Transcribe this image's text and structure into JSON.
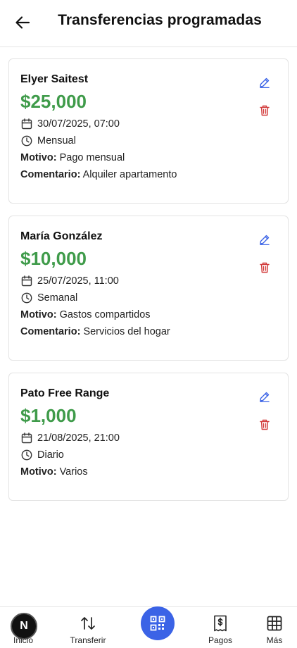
{
  "header": {
    "title": "Transferencias programadas"
  },
  "transfers": [
    {
      "recipient": "Elyer Saitest",
      "amount": "$25,000",
      "datetime": "30/07/2025, 07:00",
      "frequency": "Mensual",
      "motivo_label": "Motivo:",
      "motivo": "Pago mensual",
      "comentario_label": "Comentario:",
      "comentario": "Alquiler apartamento"
    },
    {
      "recipient": "María González",
      "amount": "$10,000",
      "datetime": "25/07/2025, 11:00",
      "frequency": "Semanal",
      "motivo_label": "Motivo:",
      "motivo": "Gastos compartidos",
      "comentario_label": "Comentario:",
      "comentario": "Servicios del hogar"
    },
    {
      "recipient": "Pato Free Range",
      "amount": "$1,000",
      "datetime": "21/08/2025, 21:00",
      "frequency": "Diario",
      "motivo_label": "Motivo:",
      "motivo": "Varios"
    }
  ],
  "bottom_nav": {
    "home": {
      "label": "Inicio",
      "avatar_letter": "N"
    },
    "transfer": {
      "label": "Transferir"
    },
    "pay": {
      "label": "Pagos"
    },
    "more": {
      "label": "Más"
    }
  },
  "colors": {
    "amount": "#3f9b4a",
    "edit_icon": "#3b63e6",
    "delete_icon": "#d23b3b",
    "qr_button": "#3b63e6"
  },
  "icons": {
    "back": "arrow-left-icon",
    "calendar": "calendar-icon",
    "clock": "clock-icon",
    "edit": "pencil-icon",
    "delete": "trash-icon",
    "transfer": "arrows-up-down-icon",
    "qr": "qr-code-icon",
    "pay": "receipt-dollar-icon",
    "more": "grid-icon"
  }
}
